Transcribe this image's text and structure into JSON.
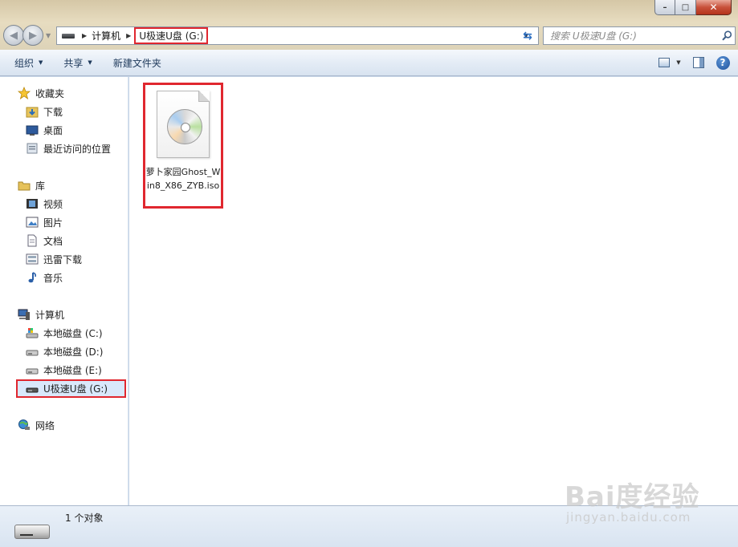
{
  "window": {
    "controls": {
      "minimize": "–",
      "maximize": "□",
      "close": "✕"
    }
  },
  "address": {
    "crumbs": [
      "计算机",
      "U极速U盘 (G:)"
    ],
    "search_placeholder": "搜索 U极速U盘 (G:)"
  },
  "toolbar": {
    "organize": "组织",
    "share": "共享",
    "new_folder": "新建文件夹"
  },
  "sidebar": {
    "favorites": "收藏夹",
    "downloads": "下载",
    "desktop": "桌面",
    "recent": "最近访问的位置",
    "libraries": "库",
    "videos": "视频",
    "pictures": "图片",
    "documents": "文档",
    "xunlei": "迅雷下载",
    "music": "音乐",
    "computer": "计算机",
    "drive_c": "本地磁盘 (C:)",
    "drive_d": "本地磁盘 (D:)",
    "drive_e": "本地磁盘 (E:)",
    "drive_g": "U极速U盘 (G:)",
    "network": "网络"
  },
  "files": [
    {
      "name": "萝卜家园Ghost_Win8_X86_ZYB.iso",
      "icon": "disc-image-icon"
    }
  ],
  "status": {
    "count": "1 个对象"
  },
  "watermark": {
    "logo": "Bai度经验",
    "url": "jingyan.baidu.com"
  },
  "colors": {
    "highlight": "#e0272f",
    "selection": "#d9e8fb"
  }
}
